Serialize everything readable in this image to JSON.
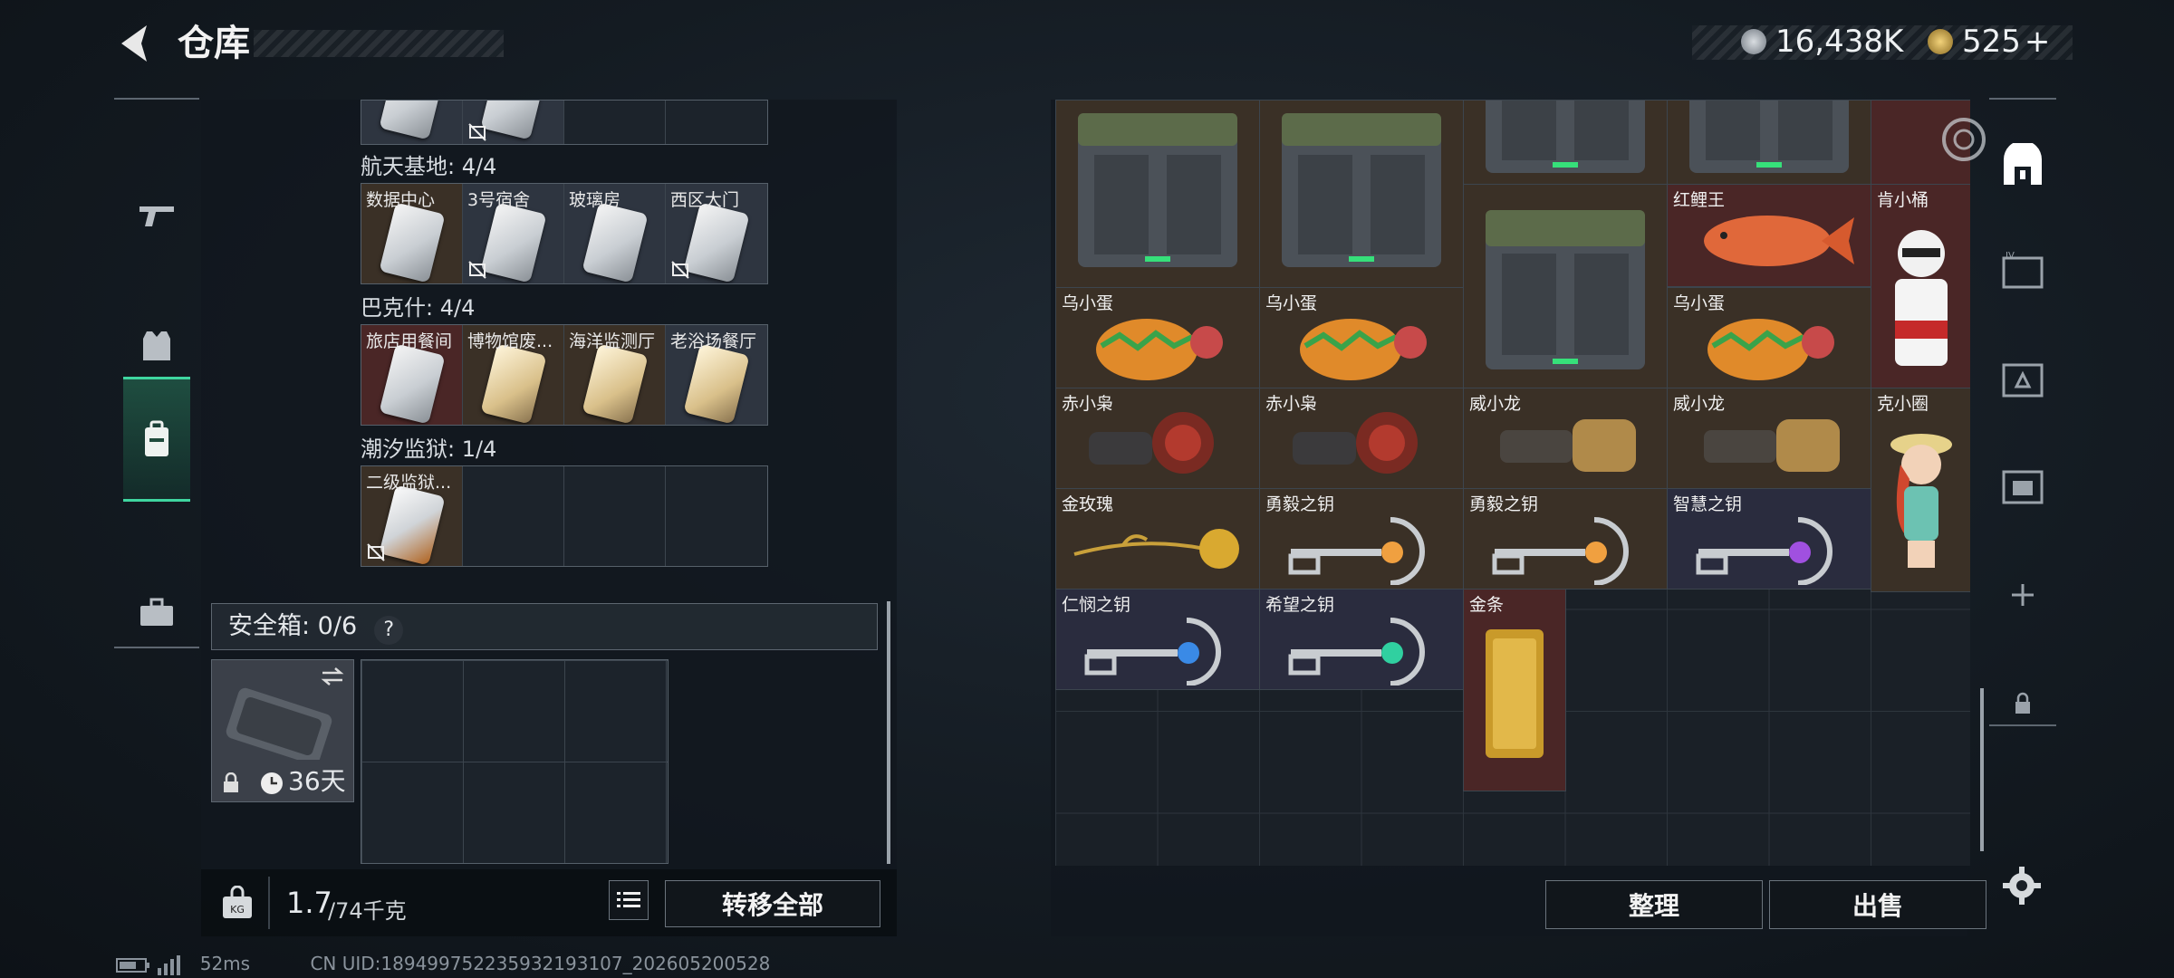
{
  "header": {
    "title": "仓库",
    "currency1": "16,438K",
    "currency2": "525",
    "plus": "+"
  },
  "left": {
    "sections": [
      {
        "title": "航天基地: 4/4",
        "items": [
          "数据中心",
          "3号宿舍",
          "玻璃房",
          "西区大门"
        ]
      },
      {
        "title": "巴克什: 4/4",
        "items": [
          "旅店用餐间",
          "博物馆废...",
          "海洋监测厅",
          "老浴场餐厅"
        ]
      },
      {
        "title": "潮汐监狱: 1/4",
        "items": [
          "二级监狱..."
        ]
      }
    ],
    "safe_box": {
      "label": "安全箱: 0/6",
      "help": "?",
      "duration": "36天"
    },
    "weight": {
      "current": "1.7",
      "max": "/74千克"
    },
    "transfer_all": "转移全部"
  },
  "right": {
    "items": [
      "红鲤王",
      "肯小桶",
      "乌小蛋",
      "乌小蛋",
      "乌小蛋",
      "赤小枭",
      "赤小枭",
      "威小龙",
      "威小龙",
      "克小圈",
      "金玫瑰",
      "勇毅之钥",
      "勇毅之钥",
      "智慧之钥",
      "仁悯之钥",
      "希望之钥",
      "金条"
    ],
    "sort_button": "整理",
    "sell_button": "出售"
  },
  "status": {
    "ping": "52ms",
    "uid": "CN UID:18949975223593219310​7_202605200528"
  },
  "colors": {
    "accent": "#3fd6a0",
    "brown_bg": "#3a3026",
    "red_bg": "#4a2626",
    "blue_bg": "#2a2c3e"
  }
}
